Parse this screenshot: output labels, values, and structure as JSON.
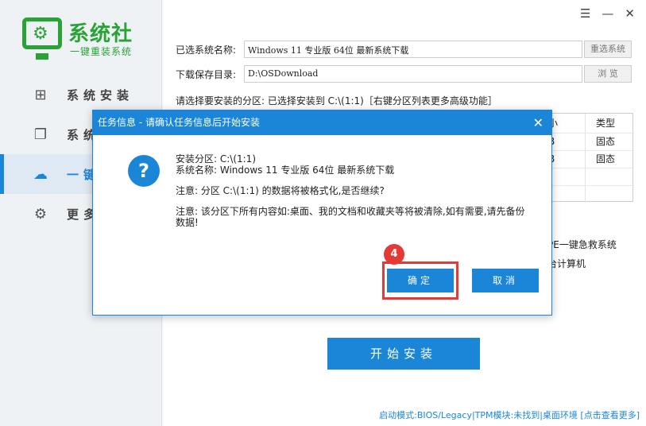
{
  "brand": {
    "name": "系统社",
    "slogan": "一键重装系统"
  },
  "sidebar": {
    "items": [
      {
        "label": "系统安装",
        "icon": "windows-icon"
      },
      {
        "label": "系统",
        "icon": "copy-icon"
      },
      {
        "label": "一键",
        "icon": "cloud-icon"
      },
      {
        "label": "更多",
        "icon": "gear-icon"
      }
    ]
  },
  "window": {
    "menu": "☰",
    "minimize": "—",
    "close": "✕"
  },
  "form": {
    "system_label": "已选系统名称:",
    "system_value": "Windows 11 专业版  64位  最新系统下载",
    "reselect_button": "重选系统",
    "save_label": "下载保存目录:",
    "save_value": "D:\\OSDownload",
    "browse_button": "浏 览"
  },
  "prompt": "请选择要安装的分区: 已选择安装到 C:\\(1:1)［右键分区列表更多高级功能］",
  "partition_table": {
    "columns": [
      "小",
      "类型"
    ],
    "rows": [
      {
        "size": "B",
        "type": "固态"
      },
      {
        "size": "B",
        "type": "固态"
      }
    ]
  },
  "side_options": [
    "PE一键急救系统",
    "台计算机"
  ],
  "install_button": "开始安装",
  "status_bar": "启动模式:BIOS/Legacy|TPM模块:未找到|桌面环境 [点击查看更多]",
  "dialog": {
    "title": "任务信息 - 请确认任务信息后开始安装",
    "close": "✕",
    "icon": "question-icon",
    "line_partition": "安装分区: C:\\(1:1)",
    "line_system": "系统名称: Windows 11 专业版  64位  最新系统下载",
    "line_notice": "注意: 分区 C:\\(1:1) 的数据将被格式化,是否继续?",
    "line_warning": "注意: 该分区下所有内容如:桌面、我的文档和收藏夹等将被清除,如有需要,请先备份数据!",
    "confirm_button": "确定",
    "cancel_button": "取消",
    "step_badge": "4"
  },
  "colors": {
    "accent": "#1b86d8",
    "brand_green": "#2aa336",
    "highlight_red": "#e53935"
  }
}
